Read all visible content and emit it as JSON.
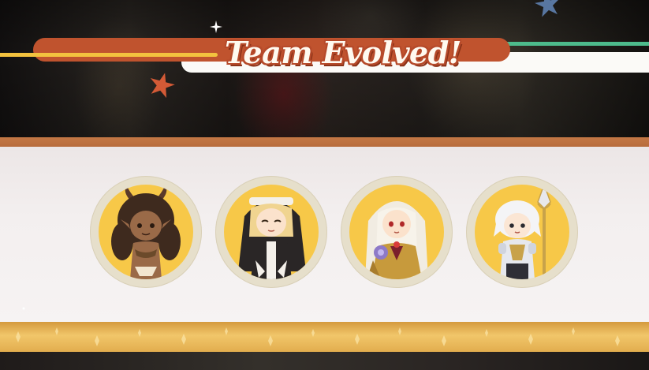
{
  "result_banner": {
    "title": "Team Evolved!",
    "colors": {
      "banner_orange": "#c0532e",
      "banner_white": "#fbfaf7",
      "accent_yellow": "#f3c23e",
      "accent_green": "#4dbb8c",
      "slot_gold": "#f7c848"
    }
  },
  "decorations": {
    "star_orange": "star-icon",
    "star_blue": "star-icon",
    "sparkle": "sparkle-icon"
  },
  "team": {
    "members": [
      {
        "portrait": "horned-demon-girl-chibi"
      },
      {
        "portrait": "blonde-nun-chibi"
      },
      {
        "portrait": "white-haired-priestess-chibi"
      },
      {
        "portrait": "silver-haired-lancer-chibi"
      }
    ]
  }
}
